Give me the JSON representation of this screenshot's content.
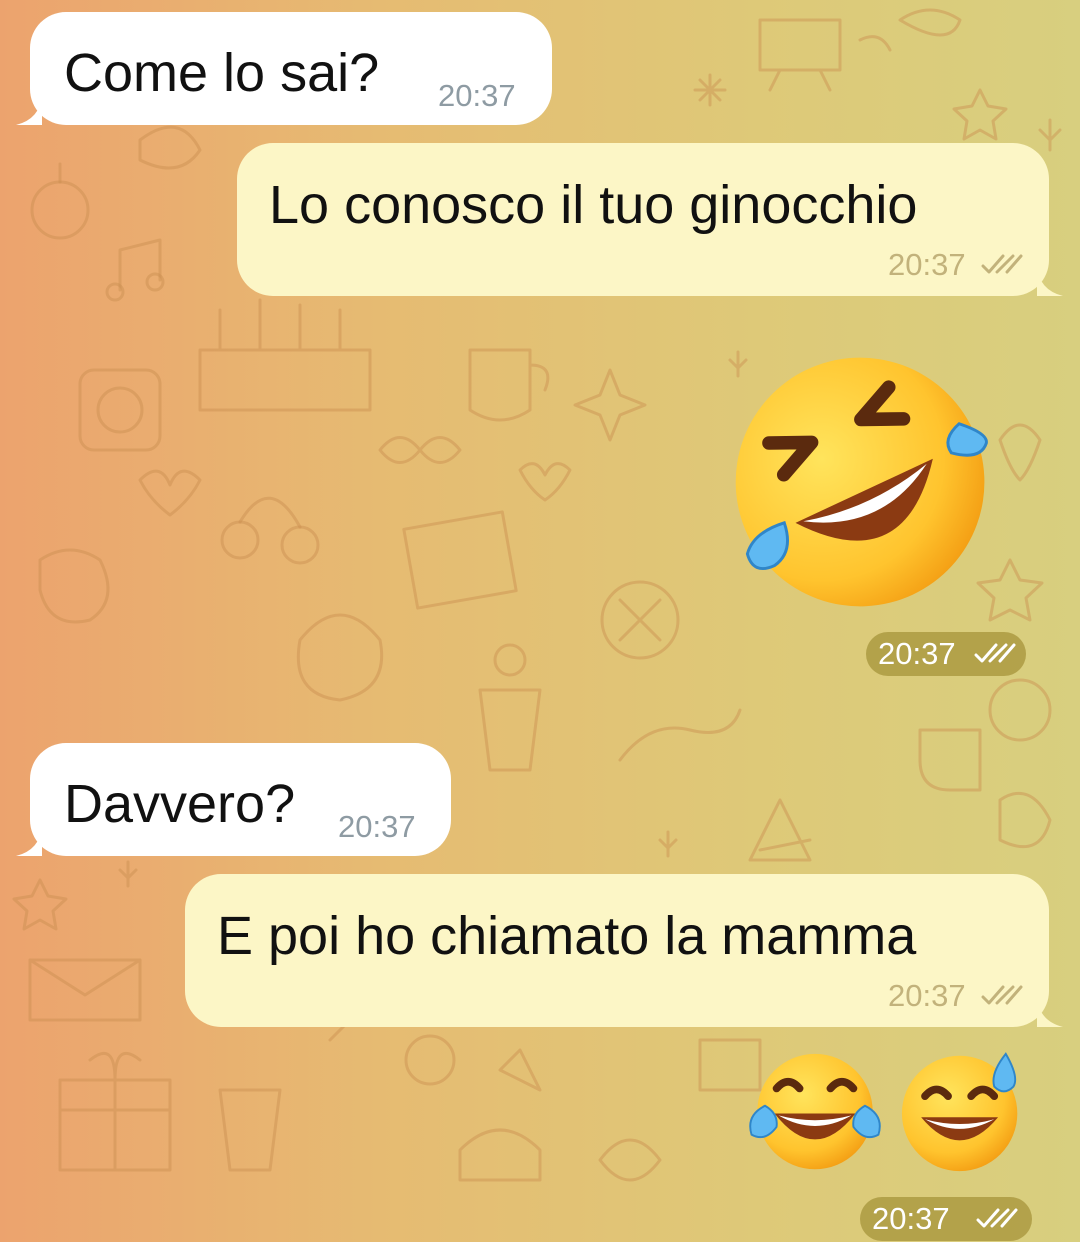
{
  "chat": {
    "messages": [
      {
        "direction": "incoming",
        "text": "Come lo sai?",
        "time": "20:37"
      },
      {
        "direction": "outgoing",
        "text": "Lo conosco il tuo ginocchio",
        "time": "20:37",
        "status": "read"
      },
      {
        "direction": "outgoing",
        "type": "emoji",
        "emoji": "rolling-on-the-floor-laughing",
        "time": "20:37",
        "status": "read"
      },
      {
        "direction": "incoming",
        "text": "Davvero?",
        "time": "20:37"
      },
      {
        "direction": "outgoing",
        "text": "E poi ho chiamato la mamma",
        "time": "20:37",
        "status": "read"
      },
      {
        "direction": "outgoing",
        "type": "emoji",
        "emoji": [
          "face-with-tears-of-joy",
          "grinning-face-with-sweat"
        ],
        "time": "20:37",
        "status": "read"
      }
    ]
  },
  "colors": {
    "incoming_bubble": "#ffffff",
    "outgoing_bubble": "#fcf6c6",
    "background_left": "#eca36e",
    "background_right": "#d8cf7f",
    "time_outgoing": "#c2b27b",
    "time_incoming": "#8e9ba3"
  }
}
